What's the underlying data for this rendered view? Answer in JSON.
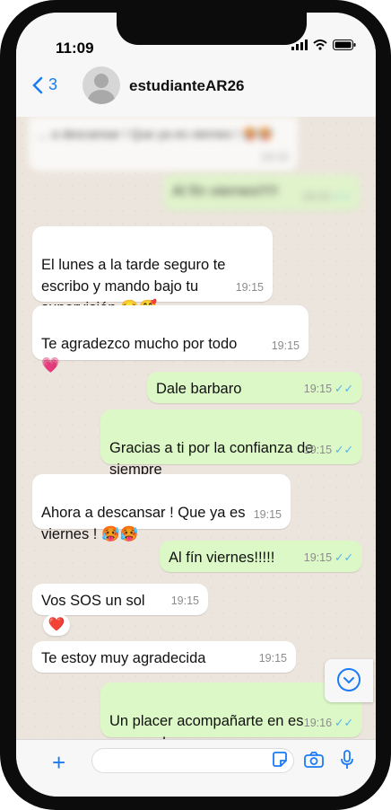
{
  "status_bar": {
    "time": "11:09"
  },
  "header": {
    "back_count": "3",
    "contact_name": "estudianteAR26"
  },
  "messages": [
    {
      "text": "... a descansar ! Que ya es viernes ! 🥵🥵",
      "time": "19:15"
    },
    {
      "text": "Al fín viernes!!!!!",
      "time": "19:15"
    },
    {
      "text": "El lunes a la tarde seguro te\nescribo y mando bajo tu\nsupervisión 😏🥰",
      "time": "19:15"
    },
    {
      "text": "Te agradezco mucho por todo\n💗",
      "time": "19:15"
    },
    {
      "text": "Dale barbaro",
      "time": "19:15"
    },
    {
      "text": "Gracias a ti por la confianza de\nsiempre",
      "time": "19:15"
    },
    {
      "text": "Ahora a descansar ! Que ya es\nviernes ! 🥵🥵",
      "time": "19:15"
    },
    {
      "text": "Al fín viernes!!!!!",
      "time": "19:15"
    },
    {
      "text": "Vos SOS un sol",
      "time": "19:15",
      "reaction": "❤️"
    },
    {
      "text": "Te estoy muy agradecida",
      "time": "19:15"
    },
    {
      "text": "Un placer acompañarte en es\nproceso!",
      "time": "19:16"
    }
  ],
  "colors": {
    "accent": "#1a7cf5",
    "outgoing_bubble": "#dcf8c6",
    "incoming_bubble": "#ffffff",
    "read_ticks": "#4fb6ec"
  },
  "icons": [
    "back-chevron-icon",
    "signal-icon",
    "wifi-icon",
    "battery-icon",
    "plus-icon",
    "sticker-icon",
    "camera-icon",
    "microphone-icon",
    "chevron-down-icon",
    "double-check-icon"
  ]
}
